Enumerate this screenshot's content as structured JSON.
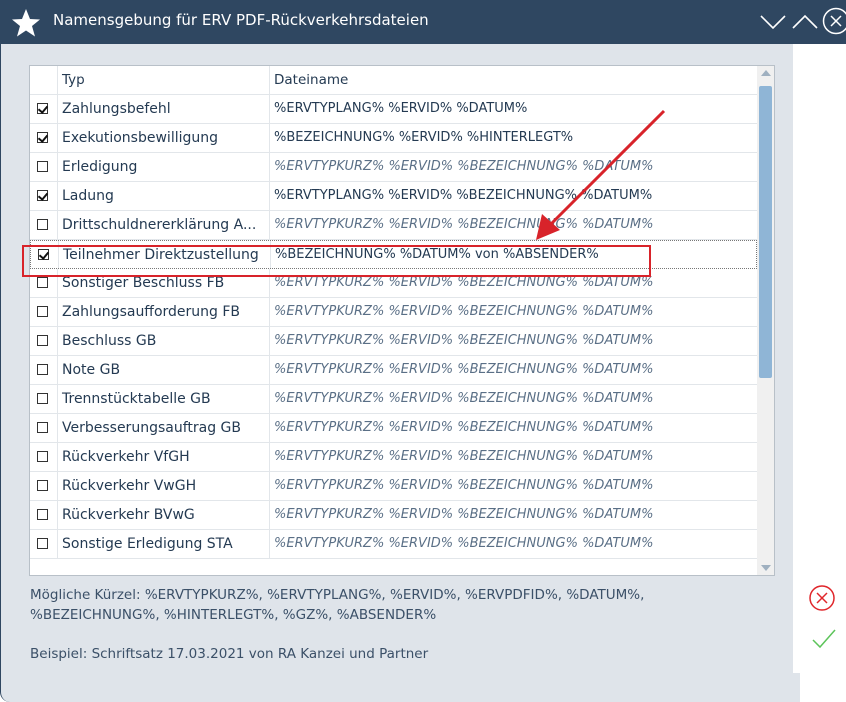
{
  "window": {
    "title": "Namensgebung für ERV PDF-Rückverkehrsdateien"
  },
  "titlebar_icons": [
    "star-icon",
    "chevron-down-icon",
    "chevron-up-icon",
    "close-icon"
  ],
  "columns": {
    "typ": "Typ",
    "dateiname": "Dateiname"
  },
  "rows": [
    {
      "checked": true,
      "typ": "Zahlungsbefehl",
      "name": "%ERVTYPLANG% %ERVID% %DATUM%",
      "italic": false
    },
    {
      "checked": true,
      "typ": "Exekutionsbewilligung",
      "name": "%BEZEICHNUNG% %ERVID% %HINTERLEGT%",
      "italic": false
    },
    {
      "checked": false,
      "typ": "Erledigung",
      "name": "%ERVTYPKURZ% %ERVID% %BEZEICHNUNG% %DATUM%",
      "italic": true
    },
    {
      "checked": true,
      "typ": "Ladung",
      "name": "%ERVTYPLANG% %ERVID% %BEZEICHNUNG% %DATUM%",
      "italic": false
    },
    {
      "checked": false,
      "typ": "Drittschuldnererklärung A...",
      "name": "%ERVTYPKURZ% %ERVID% %BEZEICHNUNG% %DATUM%",
      "italic": true
    },
    {
      "checked": true,
      "typ": "Teilnehmer Direktzustellung",
      "name": "%BEZEICHNUNG% %DATUM% von %ABSENDER%",
      "italic": false
    },
    {
      "checked": false,
      "typ": "Sonstiger Beschluss FB",
      "name": "%ERVTYPKURZ% %ERVID% %BEZEICHNUNG% %DATUM%",
      "italic": true
    },
    {
      "checked": false,
      "typ": "Zahlungsaufforderung FB",
      "name": "%ERVTYPKURZ% %ERVID% %BEZEICHNUNG% %DATUM%",
      "italic": true
    },
    {
      "checked": false,
      "typ": "Beschluss GB",
      "name": "%ERVTYPKURZ% %ERVID% %BEZEICHNUNG% %DATUM%",
      "italic": true
    },
    {
      "checked": false,
      "typ": "Note GB",
      "name": "%ERVTYPKURZ% %ERVID% %BEZEICHNUNG% %DATUM%",
      "italic": true
    },
    {
      "checked": false,
      "typ": "Trennstücktabelle GB",
      "name": "%ERVTYPKURZ% %ERVID% %BEZEICHNUNG% %DATUM%",
      "italic": true
    },
    {
      "checked": false,
      "typ": "Verbesserungsauftrag GB",
      "name": "%ERVTYPKURZ% %ERVID% %BEZEICHNUNG% %DATUM%",
      "italic": true
    },
    {
      "checked": false,
      "typ": "Rückverkehr VfGH",
      "name": "%ERVTYPKURZ% %ERVID% %BEZEICHNUNG% %DATUM%",
      "italic": true
    },
    {
      "checked": false,
      "typ": "Rückverkehr VwGH",
      "name": "%ERVTYPKURZ% %ERVID% %BEZEICHNUNG% %DATUM%",
      "italic": true
    },
    {
      "checked": false,
      "typ": "Rückverkehr BVwG",
      "name": "%ERVTYPKURZ% %ERVID% %BEZEICHNUNG% %DATUM%",
      "italic": true
    },
    {
      "checked": false,
      "typ": "Sonstige Erledigung STA",
      "name": "%ERVTYPKURZ% %ERVID% %BEZEICHNUNG% %DATUM%",
      "italic": true
    }
  ],
  "selected_row_index": 5,
  "info": {
    "kuerzel_line1": "Mögliche Kürzel: %ERVTYPKURZ%, %ERVTYPLANG%, %ERVID%, %ERVPDFID%, %DATUM%,",
    "kuerzel_line2": "%BEZEICHNUNG%, %HINTERLEGT%, %GZ%, %ABSENDER%",
    "example": "Beispiel: Schriftsatz 17.03.2021 von RA Kanzei und Partner"
  },
  "colors": {
    "titlebar": "#2f4761",
    "highlight": "#d8232a",
    "cancel": "#e0262b",
    "ok": "#5cc45a",
    "thumb": "#8fb5d6"
  }
}
